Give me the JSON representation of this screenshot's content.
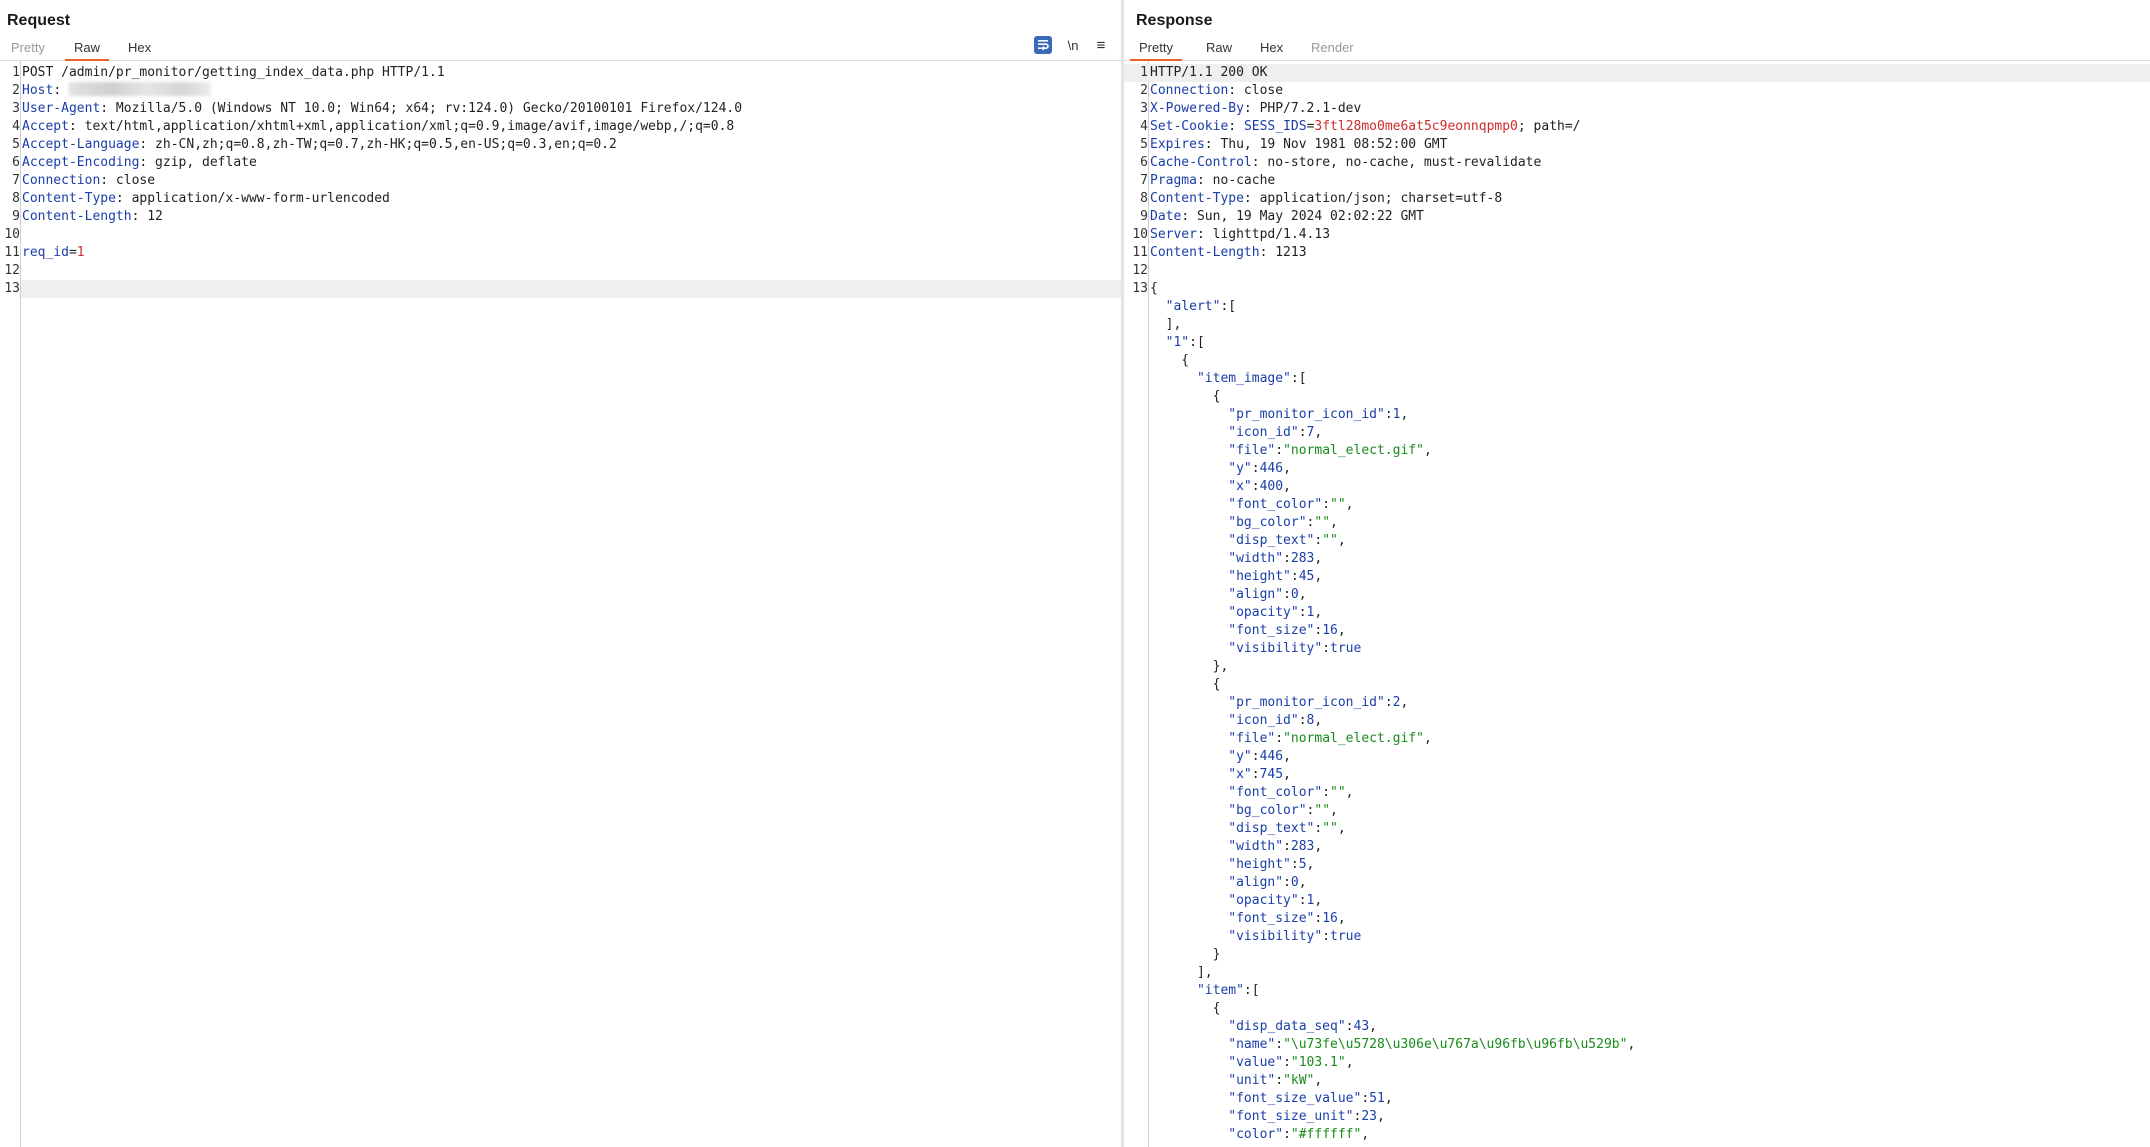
{
  "request": {
    "title": "Request",
    "tabs": [
      {
        "label": "Pretty",
        "state": "dim"
      },
      {
        "label": "Raw",
        "state": "active"
      },
      {
        "label": "Hex",
        "state": "normal"
      }
    ],
    "toolbar": {
      "newline_label": "\\n",
      "menu_label": "≡"
    },
    "lines": [
      [
        {
          "t": "POST /admin/pr_monitor/getting_index_data.php HTTP/1.1",
          "c": "hv"
        }
      ],
      [
        {
          "t": "Host",
          "c": "hk"
        },
        {
          "t": ": ",
          "c": "hv"
        },
        {
          "blur": true
        }
      ],
      [
        {
          "t": "User-Agent",
          "c": "hk"
        },
        {
          "t": ": Mozilla/5.0 (Windows NT 10.0; Win64; x64; rv:124.0) Gecko/20100101 Firefox/124.0",
          "c": "hv"
        }
      ],
      [
        {
          "t": "Accept",
          "c": "hk"
        },
        {
          "t": ": text/html,application/xhtml+xml,application/xml;q=0.9,image/avif,image/webp,/;q=0.8",
          "c": "hv"
        }
      ],
      [
        {
          "t": "Accept-Language",
          "c": "hk"
        },
        {
          "t": ": zh-CN,zh;q=0.8,zh-TW;q=0.7,zh-HK;q=0.5,en-US;q=0.3,en;q=0.2",
          "c": "hv"
        }
      ],
      [
        {
          "t": "Accept-Encoding",
          "c": "hk"
        },
        {
          "t": ": gzip, deflate",
          "c": "hv"
        }
      ],
      [
        {
          "t": "Connection",
          "c": "hk"
        },
        {
          "t": ": close",
          "c": "hv"
        }
      ],
      [
        {
          "t": "Content-Type",
          "c": "hk"
        },
        {
          "t": ": application/x-www-form-urlencoded",
          "c": "hv"
        }
      ],
      [
        {
          "t": "Content-Length",
          "c": "hk"
        },
        {
          "t": ": 12",
          "c": "hv"
        }
      ],
      [],
      [
        {
          "t": "req_id",
          "c": "hk"
        },
        {
          "t": "=",
          "c": "hv"
        },
        {
          "t": "1",
          "c": "red"
        }
      ],
      [],
      []
    ],
    "highlight_line": 13
  },
  "response": {
    "title": "Response",
    "tabs": [
      {
        "label": "Pretty",
        "state": "active"
      },
      {
        "label": "Raw",
        "state": "normal"
      },
      {
        "label": "Hex",
        "state": "normal"
      },
      {
        "label": "Render",
        "state": "dim"
      }
    ],
    "lines": [
      {
        "n": "1",
        "hl": true,
        "s": [
          {
            "t": "HTTP/1.1 200 OK",
            "c": "hv"
          }
        ]
      },
      {
        "n": "2",
        "s": [
          {
            "t": "Connection",
            "c": "hk"
          },
          {
            "t": ": close",
            "c": "hv"
          }
        ]
      },
      {
        "n": "3",
        "s": [
          {
            "t": "X-Powered-By",
            "c": "hk"
          },
          {
            "t": ": PHP/7.2.1-dev",
            "c": "hv"
          }
        ]
      },
      {
        "n": "4",
        "s": [
          {
            "t": "Set-Cookie",
            "c": "hk"
          },
          {
            "t": ": ",
            "c": "hv"
          },
          {
            "t": "SESS_IDS",
            "c": "hk"
          },
          {
            "t": "=",
            "c": "hv"
          },
          {
            "t": "3ftl28mo0me6at5c9eonnqpmp0",
            "c": "red"
          },
          {
            "t": "; path=/",
            "c": "hv"
          }
        ]
      },
      {
        "n": "5",
        "s": [
          {
            "t": "Expires",
            "c": "hk"
          },
          {
            "t": ": Thu, 19 Nov 1981 08:52:00 GMT",
            "c": "hv"
          }
        ]
      },
      {
        "n": "6",
        "s": [
          {
            "t": "Cache-Control",
            "c": "hk"
          },
          {
            "t": ": no-store, no-cache, must-revalidate",
            "c": "hv"
          }
        ]
      },
      {
        "n": "7",
        "s": [
          {
            "t": "Pragma",
            "c": "hk"
          },
          {
            "t": ": no-cache",
            "c": "hv"
          }
        ]
      },
      {
        "n": "8",
        "s": [
          {
            "t": "Content-Type",
            "c": "hk"
          },
          {
            "t": ": application/json; charset=utf-8",
            "c": "hv"
          }
        ]
      },
      {
        "n": "9",
        "s": [
          {
            "t": "Date",
            "c": "hk"
          },
          {
            "t": ": Sun, 19 May 2024 02:02:22 GMT",
            "c": "hv"
          }
        ]
      },
      {
        "n": "10",
        "s": [
          {
            "t": "Server",
            "c": "hk"
          },
          {
            "t": ": lighttpd/1.4.13",
            "c": "hv"
          }
        ]
      },
      {
        "n": "11",
        "s": [
          {
            "t": "Content-Length",
            "c": "hk"
          },
          {
            "t": ": 1213",
            "c": "hv"
          }
        ]
      },
      {
        "n": "12",
        "s": []
      },
      {
        "n": "13",
        "s": [
          {
            "t": "{",
            "c": "jp"
          }
        ]
      },
      {
        "n": "",
        "s": [
          {
            "t": "  \"alert\"",
            "c": "jk"
          },
          {
            "t": ":[",
            "c": "jp"
          }
        ]
      },
      {
        "n": "",
        "s": [
          {
            "t": "  ],",
            "c": "jp"
          }
        ]
      },
      {
        "n": "",
        "s": [
          {
            "t": "  \"1\"",
            "c": "jk"
          },
          {
            "t": ":[",
            "c": "jp"
          }
        ]
      },
      {
        "n": "",
        "s": [
          {
            "t": "    {",
            "c": "jp"
          }
        ]
      },
      {
        "n": "",
        "s": [
          {
            "t": "      \"item_image\"",
            "c": "jk"
          },
          {
            "t": ":[",
            "c": "jp"
          }
        ]
      },
      {
        "n": "",
        "s": [
          {
            "t": "        {",
            "c": "jp"
          }
        ]
      },
      {
        "n": "",
        "s": [
          {
            "t": "          \"pr_monitor_icon_id\"",
            "c": "jk"
          },
          {
            "t": ":",
            "c": "jp"
          },
          {
            "t": "1",
            "c": "jn"
          },
          {
            "t": ",",
            "c": "jp"
          }
        ]
      },
      {
        "n": "",
        "s": [
          {
            "t": "          \"icon_id\"",
            "c": "jk"
          },
          {
            "t": ":",
            "c": "jp"
          },
          {
            "t": "7",
            "c": "jn"
          },
          {
            "t": ",",
            "c": "jp"
          }
        ]
      },
      {
        "n": "",
        "s": [
          {
            "t": "          \"file\"",
            "c": "jk"
          },
          {
            "t": ":",
            "c": "jp"
          },
          {
            "t": "\"normal_elect.gif\"",
            "c": "js"
          },
          {
            "t": ",",
            "c": "jp"
          }
        ]
      },
      {
        "n": "",
        "s": [
          {
            "t": "          \"y\"",
            "c": "jk"
          },
          {
            "t": ":",
            "c": "jp"
          },
          {
            "t": "446",
            "c": "jn"
          },
          {
            "t": ",",
            "c": "jp"
          }
        ]
      },
      {
        "n": "",
        "s": [
          {
            "t": "          \"x\"",
            "c": "jk"
          },
          {
            "t": ":",
            "c": "jp"
          },
          {
            "t": "400",
            "c": "jn"
          },
          {
            "t": ",",
            "c": "jp"
          }
        ]
      },
      {
        "n": "",
        "s": [
          {
            "t": "          \"font_color\"",
            "c": "jk"
          },
          {
            "t": ":",
            "c": "jp"
          },
          {
            "t": "\"\"",
            "c": "js"
          },
          {
            "t": ",",
            "c": "jp"
          }
        ]
      },
      {
        "n": "",
        "s": [
          {
            "t": "          \"bg_color\"",
            "c": "jk"
          },
          {
            "t": ":",
            "c": "jp"
          },
          {
            "t": "\"\"",
            "c": "js"
          },
          {
            "t": ",",
            "c": "jp"
          }
        ]
      },
      {
        "n": "",
        "s": [
          {
            "t": "          \"disp_text\"",
            "c": "jk"
          },
          {
            "t": ":",
            "c": "jp"
          },
          {
            "t": "\"\"",
            "c": "js"
          },
          {
            "t": ",",
            "c": "jp"
          }
        ]
      },
      {
        "n": "",
        "s": [
          {
            "t": "          \"width\"",
            "c": "jk"
          },
          {
            "t": ":",
            "c": "jp"
          },
          {
            "t": "283",
            "c": "jn"
          },
          {
            "t": ",",
            "c": "jp"
          }
        ]
      },
      {
        "n": "",
        "s": [
          {
            "t": "          \"height\"",
            "c": "jk"
          },
          {
            "t": ":",
            "c": "jp"
          },
          {
            "t": "45",
            "c": "jn"
          },
          {
            "t": ",",
            "c": "jp"
          }
        ]
      },
      {
        "n": "",
        "s": [
          {
            "t": "          \"align\"",
            "c": "jk"
          },
          {
            "t": ":",
            "c": "jp"
          },
          {
            "t": "0",
            "c": "jn"
          },
          {
            "t": ",",
            "c": "jp"
          }
        ]
      },
      {
        "n": "",
        "s": [
          {
            "t": "          \"opacity\"",
            "c": "jk"
          },
          {
            "t": ":",
            "c": "jp"
          },
          {
            "t": "1",
            "c": "jn"
          },
          {
            "t": ",",
            "c": "jp"
          }
        ]
      },
      {
        "n": "",
        "s": [
          {
            "t": "          \"font_size\"",
            "c": "jk"
          },
          {
            "t": ":",
            "c": "jp"
          },
          {
            "t": "16",
            "c": "jn"
          },
          {
            "t": ",",
            "c": "jp"
          }
        ]
      },
      {
        "n": "",
        "s": [
          {
            "t": "          \"visibility\"",
            "c": "jk"
          },
          {
            "t": ":",
            "c": "jp"
          },
          {
            "t": "true",
            "c": "jb"
          }
        ]
      },
      {
        "n": "",
        "s": [
          {
            "t": "        },",
            "c": "jp"
          }
        ]
      },
      {
        "n": "",
        "s": [
          {
            "t": "        {",
            "c": "jp"
          }
        ]
      },
      {
        "n": "",
        "s": [
          {
            "t": "          \"pr_monitor_icon_id\"",
            "c": "jk"
          },
          {
            "t": ":",
            "c": "jp"
          },
          {
            "t": "2",
            "c": "jn"
          },
          {
            "t": ",",
            "c": "jp"
          }
        ]
      },
      {
        "n": "",
        "s": [
          {
            "t": "          \"icon_id\"",
            "c": "jk"
          },
          {
            "t": ":",
            "c": "jp"
          },
          {
            "t": "8",
            "c": "jn"
          },
          {
            "t": ",",
            "c": "jp"
          }
        ]
      },
      {
        "n": "",
        "s": [
          {
            "t": "          \"file\"",
            "c": "jk"
          },
          {
            "t": ":",
            "c": "jp"
          },
          {
            "t": "\"normal_elect.gif\"",
            "c": "js"
          },
          {
            "t": ",",
            "c": "jp"
          }
        ]
      },
      {
        "n": "",
        "s": [
          {
            "t": "          \"y\"",
            "c": "jk"
          },
          {
            "t": ":",
            "c": "jp"
          },
          {
            "t": "446",
            "c": "jn"
          },
          {
            "t": ",",
            "c": "jp"
          }
        ]
      },
      {
        "n": "",
        "s": [
          {
            "t": "          \"x\"",
            "c": "jk"
          },
          {
            "t": ":",
            "c": "jp"
          },
          {
            "t": "745",
            "c": "jn"
          },
          {
            "t": ",",
            "c": "jp"
          }
        ]
      },
      {
        "n": "",
        "s": [
          {
            "t": "          \"font_color\"",
            "c": "jk"
          },
          {
            "t": ":",
            "c": "jp"
          },
          {
            "t": "\"\"",
            "c": "js"
          },
          {
            "t": ",",
            "c": "jp"
          }
        ]
      },
      {
        "n": "",
        "s": [
          {
            "t": "          \"bg_color\"",
            "c": "jk"
          },
          {
            "t": ":",
            "c": "jp"
          },
          {
            "t": "\"\"",
            "c": "js"
          },
          {
            "t": ",",
            "c": "jp"
          }
        ]
      },
      {
        "n": "",
        "s": [
          {
            "t": "          \"disp_text\"",
            "c": "jk"
          },
          {
            "t": ":",
            "c": "jp"
          },
          {
            "t": "\"\"",
            "c": "js"
          },
          {
            "t": ",",
            "c": "jp"
          }
        ]
      },
      {
        "n": "",
        "s": [
          {
            "t": "          \"width\"",
            "c": "jk"
          },
          {
            "t": ":",
            "c": "jp"
          },
          {
            "t": "283",
            "c": "jn"
          },
          {
            "t": ",",
            "c": "jp"
          }
        ]
      },
      {
        "n": "",
        "s": [
          {
            "t": "          \"height\"",
            "c": "jk"
          },
          {
            "t": ":",
            "c": "jp"
          },
          {
            "t": "5",
            "c": "jn"
          },
          {
            "t": ",",
            "c": "jp"
          }
        ]
      },
      {
        "n": "",
        "s": [
          {
            "t": "          \"align\"",
            "c": "jk"
          },
          {
            "t": ":",
            "c": "jp"
          },
          {
            "t": "0",
            "c": "jn"
          },
          {
            "t": ",",
            "c": "jp"
          }
        ]
      },
      {
        "n": "",
        "s": [
          {
            "t": "          \"opacity\"",
            "c": "jk"
          },
          {
            "t": ":",
            "c": "jp"
          },
          {
            "t": "1",
            "c": "jn"
          },
          {
            "t": ",",
            "c": "jp"
          }
        ]
      },
      {
        "n": "",
        "s": [
          {
            "t": "          \"font_size\"",
            "c": "jk"
          },
          {
            "t": ":",
            "c": "jp"
          },
          {
            "t": "16",
            "c": "jn"
          },
          {
            "t": ",",
            "c": "jp"
          }
        ]
      },
      {
        "n": "",
        "s": [
          {
            "t": "          \"visibility\"",
            "c": "jk"
          },
          {
            "t": ":",
            "c": "jp"
          },
          {
            "t": "true",
            "c": "jb"
          }
        ]
      },
      {
        "n": "",
        "s": [
          {
            "t": "        }",
            "c": "jp"
          }
        ]
      },
      {
        "n": "",
        "s": [
          {
            "t": "      ],",
            "c": "jp"
          }
        ]
      },
      {
        "n": "",
        "s": [
          {
            "t": "      \"item\"",
            "c": "jk"
          },
          {
            "t": ":[",
            "c": "jp"
          }
        ]
      },
      {
        "n": "",
        "s": [
          {
            "t": "        {",
            "c": "jp"
          }
        ]
      },
      {
        "n": "",
        "s": [
          {
            "t": "          \"disp_data_seq\"",
            "c": "jk"
          },
          {
            "t": ":",
            "c": "jp"
          },
          {
            "t": "43",
            "c": "jn"
          },
          {
            "t": ",",
            "c": "jp"
          }
        ]
      },
      {
        "n": "",
        "s": [
          {
            "t": "          \"name\"",
            "c": "jk"
          },
          {
            "t": ":",
            "c": "jp"
          },
          {
            "t": "\"\\u73fe\\u5728\\u306e\\u767a\\u96fb\\u96fb\\u529b\"",
            "c": "js"
          },
          {
            "t": ",",
            "c": "jp"
          }
        ]
      },
      {
        "n": "",
        "s": [
          {
            "t": "          \"value\"",
            "c": "jk"
          },
          {
            "t": ":",
            "c": "jp"
          },
          {
            "t": "\"103.1\"",
            "c": "js"
          },
          {
            "t": ",",
            "c": "jp"
          }
        ]
      },
      {
        "n": "",
        "s": [
          {
            "t": "          \"unit\"",
            "c": "jk"
          },
          {
            "t": ":",
            "c": "jp"
          },
          {
            "t": "\"kW\"",
            "c": "js"
          },
          {
            "t": ",",
            "c": "jp"
          }
        ]
      },
      {
        "n": "",
        "s": [
          {
            "t": "          \"font_size_value\"",
            "c": "jk"
          },
          {
            "t": ":",
            "c": "jp"
          },
          {
            "t": "51",
            "c": "jn"
          },
          {
            "t": ",",
            "c": "jp"
          }
        ]
      },
      {
        "n": "",
        "s": [
          {
            "t": "          \"font_size_unit\"",
            "c": "jk"
          },
          {
            "t": ":",
            "c": "jp"
          },
          {
            "t": "23",
            "c": "jn"
          },
          {
            "t": ",",
            "c": "jp"
          }
        ]
      },
      {
        "n": "",
        "s": [
          {
            "t": "          \"color\"",
            "c": "jk"
          },
          {
            "t": ":",
            "c": "jp"
          },
          {
            "t": "\"#ffffff\"",
            "c": "js"
          },
          {
            "t": ",",
            "c": "jp"
          }
        ]
      }
    ]
  }
}
